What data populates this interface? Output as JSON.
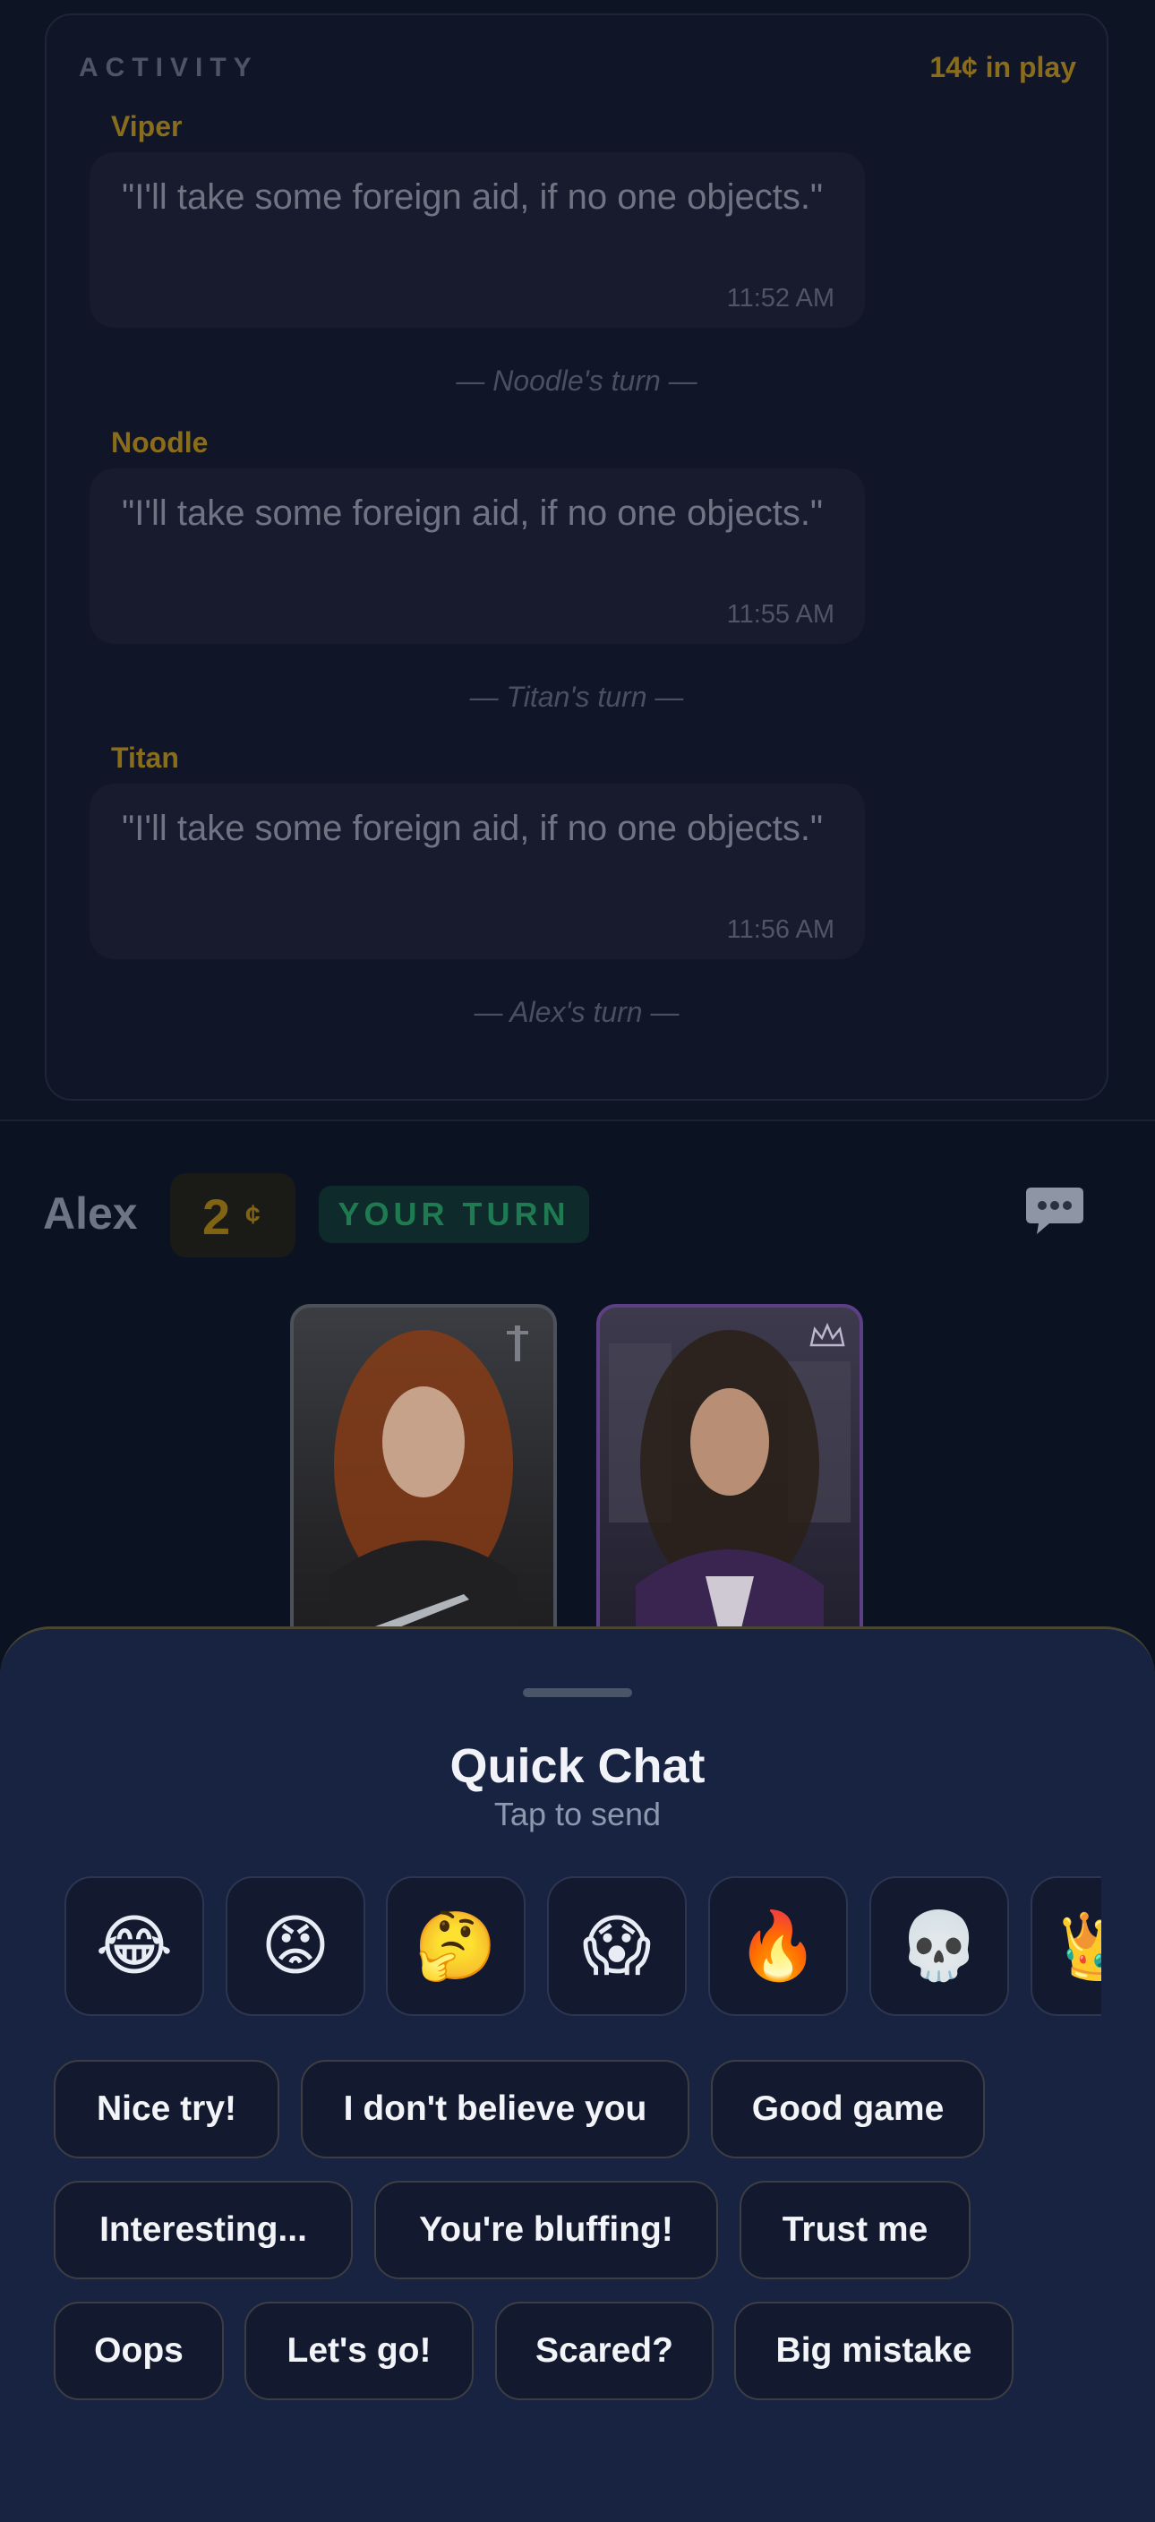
{
  "activity": {
    "title": "ACTIVITY",
    "pot": "14¢ in play",
    "messages": [
      {
        "name": "Viper",
        "text": "\"I'll take some foreign aid, if no one objects.\"",
        "time": "11:52 AM"
      },
      {
        "name": "Noodle",
        "text": "\"I'll take some foreign aid, if no one objects.\"",
        "time": "11:55 AM"
      },
      {
        "name": "Titan",
        "text": "\"I'll take some foreign aid, if no one objects.\"",
        "time": "11:56 AM"
      }
    ],
    "turns": [
      "— Noodle's turn —",
      "— Titan's turn —",
      "— Alex's turn —"
    ]
  },
  "player": {
    "name": "Alex",
    "coins": "2",
    "coin_symbol": "¢",
    "badge": "YOUR TURN",
    "chat_icon": "speech-bubble-icon",
    "cards": [
      {
        "icon": "dagger-icon",
        "accent": "#4c5058"
      },
      {
        "icon": "crown-icon",
        "accent": "#5d3f86"
      }
    ]
  },
  "quick_chat": {
    "title": "Quick Chat",
    "subtitle": "Tap to send",
    "emojis": [
      "😂",
      "😡",
      "🤔",
      "😱",
      "🔥",
      "💀",
      "👑"
    ],
    "phrases": [
      "Nice try!",
      "I don't believe you",
      "Good game",
      "Interesting...",
      "You're bluffing!",
      "Trust me",
      "Oops",
      "Let's go!",
      "Scared?",
      "Big mistake"
    ]
  },
  "colors": {
    "gold": "#8a6d1c",
    "turn_green": "#1f7a52",
    "sheet_bg": "#172341",
    "card2_border": "#5d3f86"
  }
}
